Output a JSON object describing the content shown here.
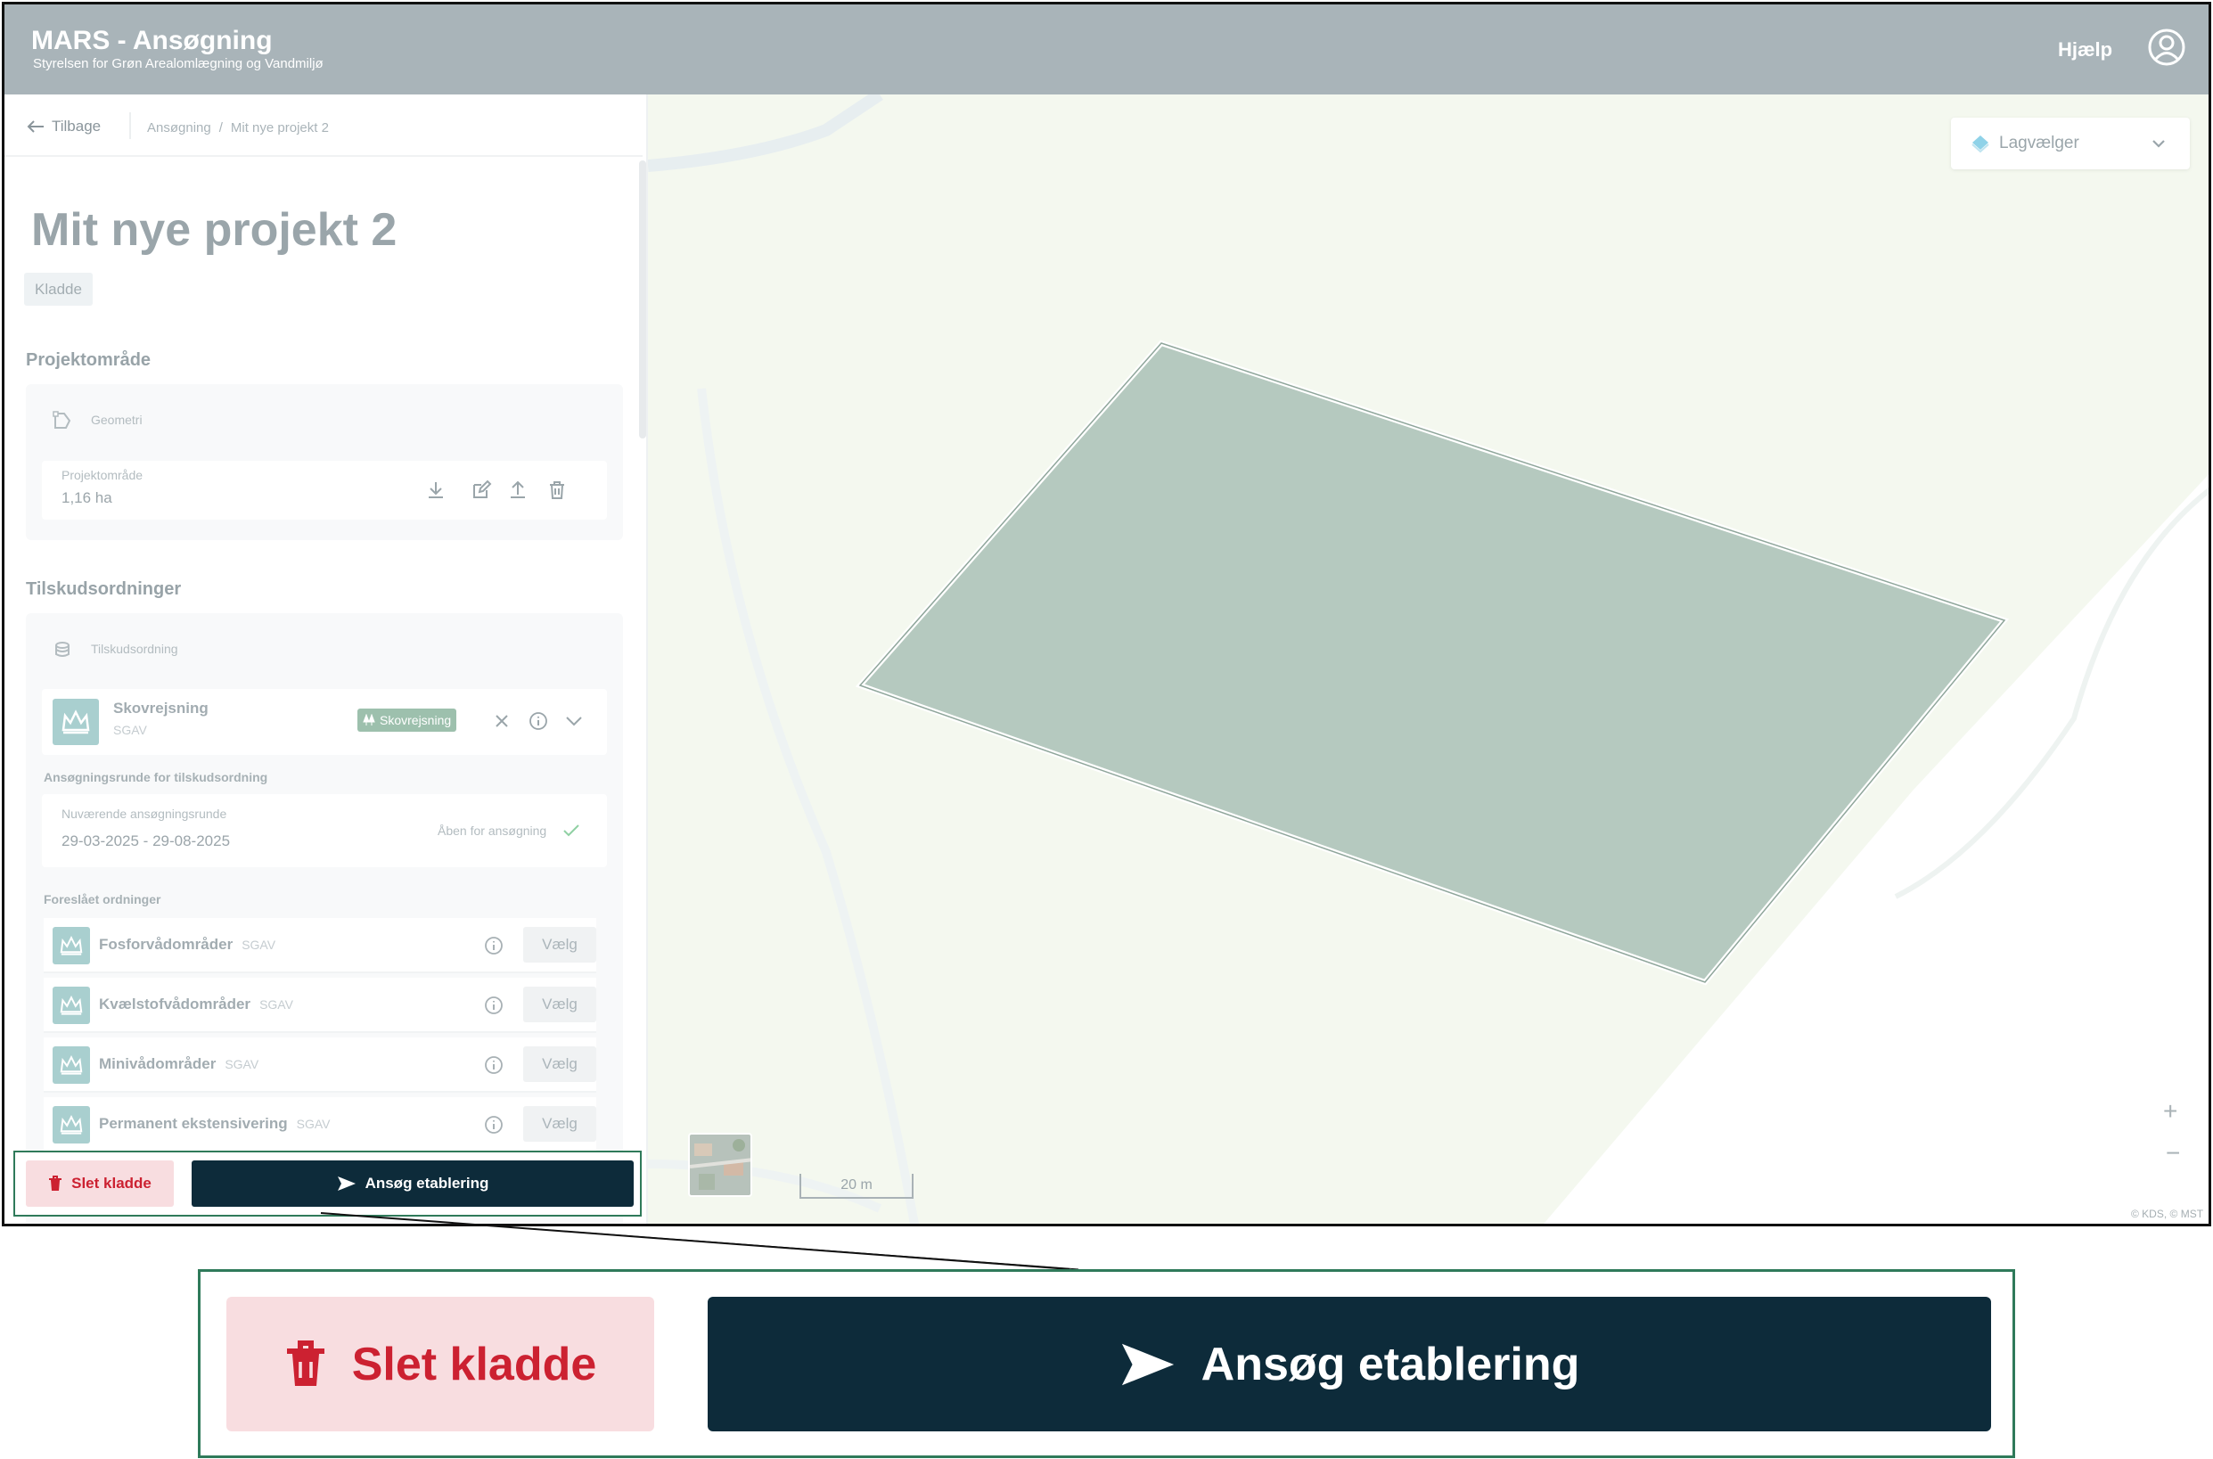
{
  "header": {
    "app_title": "MARS - Ansøgning",
    "app_subtitle": "Styrelsen for Grøn Arealomlægning og Vandmiljø",
    "help_label": "Hjælp"
  },
  "sidebar": {
    "back_label": "Tilbage",
    "breadcrumb": [
      "Ansøgning",
      "Mit nye projekt 2"
    ],
    "project_title": "Mit nye projekt 2",
    "status_badge": "Kladde",
    "project_area": {
      "heading": "Projektområde",
      "geometry_label": "Geometri",
      "area_label": "Projektområde",
      "area_value": "1,16 ha"
    },
    "schemes": {
      "heading": "Tilskudsordninger",
      "card_label": "Tilskudsordning",
      "selected": {
        "name": "Skovrejsning",
        "org": "SGAV",
        "tag": "Skovrejsning"
      },
      "round_heading": "Ansøgningsrunde for tilskudsordning",
      "round_label": "Nuværende ansøgningsrunde",
      "round_dates": "29-03-2025 - 29-08-2025",
      "round_status": "Åben for ansøgning",
      "suggested_heading": "Foreslået ordninger",
      "suggested": [
        {
          "name": "Fosforvådområder",
          "org": "SGAV",
          "action": "Vælg"
        },
        {
          "name": "Kvælstofvådområder",
          "org": "SGAV",
          "action": "Vælg"
        },
        {
          "name": "Minivådområder",
          "org": "SGAV",
          "action": "Vælg"
        },
        {
          "name": "Permanent ekstensivering",
          "org": "SGAV",
          "action": "Vælg"
        }
      ]
    },
    "actions": {
      "delete_label": "Slet kladde",
      "apply_label": "Ansøg etablering"
    }
  },
  "map": {
    "layer_picker_label": "Lagvælger",
    "scale_label": "20 m",
    "zoom_in": "+",
    "zoom_out": "−",
    "attribution": "© KDS, © MST"
  },
  "callout": {
    "delete_label": "Slet kladde",
    "apply_label": "Ansøg etablering"
  },
  "colors": {
    "header_bg": "#a9b4b9",
    "delete_bg": "#f8dde0",
    "delete_fg": "#cc2131",
    "apply_bg": "#0d2b3a",
    "highlight_border": "#2f7a5a",
    "polygon_fill": "#b5c9bf"
  }
}
